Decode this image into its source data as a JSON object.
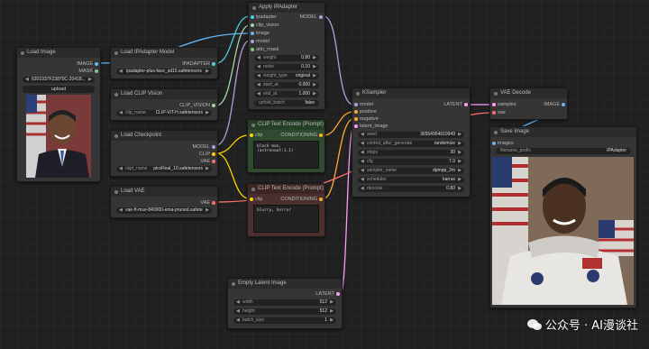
{
  "nodes": {
    "apply_ipadapter": {
      "title": "Apply IPAdapter",
      "inputs": [
        "ipadapter",
        "clip_vision",
        "image",
        "model",
        "attn_mask"
      ],
      "output": "MODEL",
      "widgets": [
        {
          "k": "weight",
          "v": "0.80"
        },
        {
          "k": "noise",
          "v": "0.10"
        },
        {
          "k": "weight_type",
          "v": "original"
        },
        {
          "k": "start_at",
          "v": "0.000"
        },
        {
          "k": "end_at",
          "v": "1.000"
        }
      ],
      "toggle_k": "unfold_batch",
      "toggle_v": "false"
    },
    "load_image": {
      "title": "Load Image",
      "outputs": [
        "IMAGE",
        "MASK"
      ],
      "file": "6201937F23870C-20418...0 (2).jpg",
      "upload": "upload"
    },
    "load_ipadapter_model": {
      "title": "Load IPAdapter Model",
      "output": "IPADAPTER",
      "file": "ipadapter-plus-face_sd15.safetensors"
    },
    "load_clip_vision": {
      "title": "Load CLIP Vision",
      "output": "CLIP_VISION",
      "k": "clip_name",
      "v": "CLIP-ViT-H.safetensors"
    },
    "load_checkpoint": {
      "title": "Load Checkpoint",
      "outputs": [
        "MODEL",
        "CLIP",
        "VAE"
      ],
      "k": "ckpt_name",
      "v": "picxReal_10.safetensors"
    },
    "load_vae": {
      "title": "Load VAE",
      "output": "VAE",
      "file": "vae-ft-mse-840000-ema-pruned.safetensors"
    },
    "clip_pos": {
      "title": "CLIP Text Encode (Prompt)",
      "input": "clip",
      "output": "CONDITIONING",
      "text": "black man, (astronaut:1.1)"
    },
    "clip_neg": {
      "title": "CLIP Text Encode (Prompt)",
      "input": "clip",
      "output": "CONDITIONING",
      "text": "blurry, horror"
    },
    "ksampler": {
      "title": "KSampler",
      "inputs": [
        "model",
        "positive",
        "negative",
        "latent_image"
      ],
      "output": "LATENT",
      "widgets": [
        {
          "k": "seed",
          "v": "36554954910949"
        },
        {
          "k": "control_after_generate",
          "v": "randomize"
        },
        {
          "k": "steps",
          "v": "30"
        },
        {
          "k": "cfg",
          "v": "7.0"
        },
        {
          "k": "sampler_name",
          "v": "dpmpp_2m"
        },
        {
          "k": "scheduler",
          "v": "karras"
        },
        {
          "k": "denoise",
          "v": "0.80"
        }
      ]
    },
    "vae_decode": {
      "title": "VAE Decode",
      "inputs": [
        "samples",
        "vae"
      ],
      "output": "IMAGE"
    },
    "save_image": {
      "title": "Save Image",
      "input": "images",
      "k": "filename_prefix",
      "v": "IPAdapter"
    },
    "empty_latent": {
      "title": "Empty Latent Image",
      "output": "LATENT",
      "widgets": [
        {
          "k": "width",
          "v": "512"
        },
        {
          "k": "height",
          "v": "512"
        },
        {
          "k": "batch_size",
          "v": "1"
        }
      ]
    }
  },
  "watermark": {
    "text": "公众号 · AI漫谈社"
  },
  "colors": {
    "model": "#b39ddb",
    "clip": "#ffd500",
    "vae": "#ff6e6e",
    "image": "#64b5f6",
    "latent": "#ff9cf9",
    "conditioning": "#ffa931",
    "ipadapter": "#4dd0e1",
    "clip_vision": "#a5d6a7"
  }
}
